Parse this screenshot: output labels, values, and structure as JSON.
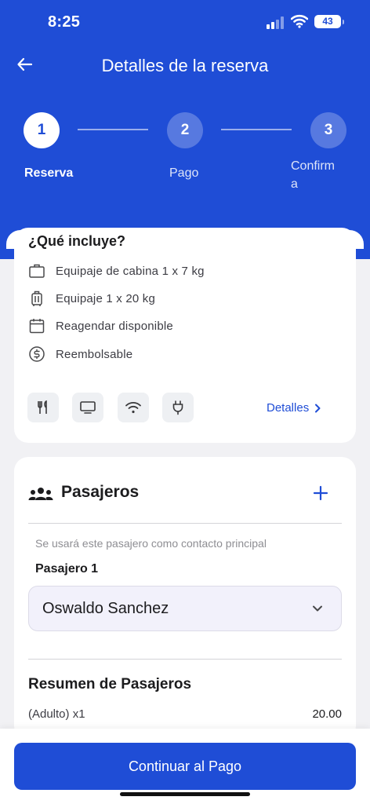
{
  "status_bar": {
    "time": "8:25",
    "battery": "43"
  },
  "header": {
    "title": "Detalles de la reserva"
  },
  "steps": [
    {
      "number": "1",
      "label": "Reserva"
    },
    {
      "number": "2",
      "label": "Pago"
    },
    {
      "number": "3",
      "label": "Confirm\na"
    }
  ],
  "includes": {
    "title": "¿Qué incluye?",
    "items": [
      {
        "icon": "briefcase-icon",
        "label": "Equipaje de cabina 1 x 7 kg"
      },
      {
        "icon": "luggage-icon",
        "label": "Equipaje 1 x 20 kg"
      },
      {
        "icon": "calendar-icon",
        "label": "Reagendar disponible"
      },
      {
        "icon": "dollar-icon",
        "label": "Reembolsable"
      }
    ],
    "amenities": [
      "meal-icon",
      "tv-icon",
      "wifi-icon",
      "power-plug-icon"
    ],
    "details_link": "Detalles"
  },
  "passengers": {
    "title": "Pasajeros",
    "note": "Se usará este pasajero como contacto principal",
    "passenger_label": "Pasajero 1",
    "selected_passenger": "Oswaldo Sanchez"
  },
  "summary": {
    "title": "Resumen de Pasajeros",
    "rows": [
      {
        "label": "(Adulto) x1",
        "value": "20.00"
      }
    ]
  },
  "cta": {
    "label": "Continuar al Pago"
  },
  "colors": {
    "primary": "#1f4dd6",
    "background": "#f1f1f4"
  }
}
